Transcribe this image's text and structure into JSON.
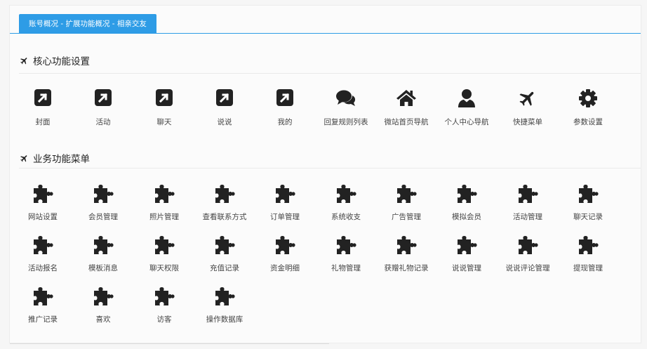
{
  "breadcrumb": "账号概况 - 扩展功能概况 - 相亲交友",
  "sections": {
    "core": {
      "title": "核心功能设置",
      "items": [
        {
          "label": "封面",
          "icon": "external-link-square-icon"
        },
        {
          "label": "活动",
          "icon": "external-link-square-icon"
        },
        {
          "label": "聊天",
          "icon": "external-link-square-icon"
        },
        {
          "label": "说说",
          "icon": "external-link-square-icon"
        },
        {
          "label": "我的",
          "icon": "external-link-square-icon"
        },
        {
          "label": "回复规则列表",
          "icon": "comments-icon"
        },
        {
          "label": "微站首页导航",
          "icon": "home-icon"
        },
        {
          "label": "个人中心导航",
          "icon": "user-icon"
        },
        {
          "label": "快捷菜单",
          "icon": "plane-icon"
        },
        {
          "label": "参数设置",
          "icon": "gear-icon"
        }
      ]
    },
    "business": {
      "title": "业务功能菜单",
      "items": [
        {
          "label": "网站设置"
        },
        {
          "label": "会员管理"
        },
        {
          "label": "照片管理"
        },
        {
          "label": "查看联系方式"
        },
        {
          "label": "订单管理"
        },
        {
          "label": "系统收支"
        },
        {
          "label": "广告管理"
        },
        {
          "label": "模拟会员"
        },
        {
          "label": "活动管理"
        },
        {
          "label": "聊天记录"
        },
        {
          "label": "活动报名"
        },
        {
          "label": "模板消息"
        },
        {
          "label": "聊天权限"
        },
        {
          "label": "充值记录"
        },
        {
          "label": "资金明细"
        },
        {
          "label": "礼物管理"
        },
        {
          "label": "获赠礼物记录"
        },
        {
          "label": "说说管理"
        },
        {
          "label": "说说评论管理"
        },
        {
          "label": "提现管理"
        },
        {
          "label": "推广记录"
        },
        {
          "label": "喜欢"
        },
        {
          "label": "访客"
        },
        {
          "label": "操作数据库"
        }
      ],
      "icon": "puzzle-icon"
    }
  },
  "colors": {
    "accent": "#2e9ce6",
    "icon": "#222222"
  }
}
